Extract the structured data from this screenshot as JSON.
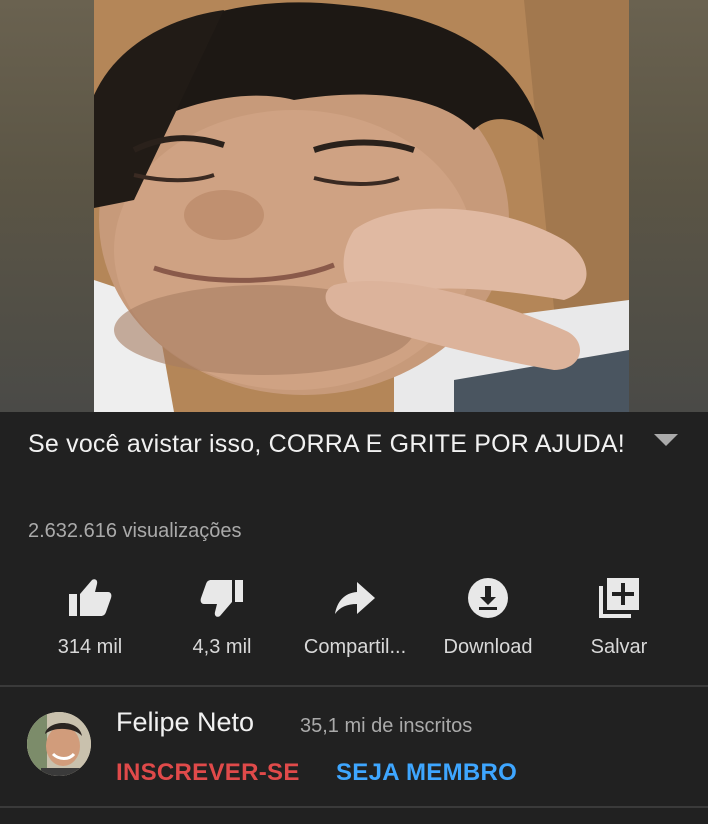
{
  "video": {
    "title": "Se você avistar isso, CORRA E GRITE POR AJUDA!",
    "views": "2.632.616 visualizações"
  },
  "actions": [
    {
      "icon": "thumbs-up-icon",
      "label": "314 mil"
    },
    {
      "icon": "thumbs-down-icon",
      "label": "4,3 mil"
    },
    {
      "icon": "share-icon",
      "label": "Compartil..."
    },
    {
      "icon": "download-icon",
      "label": "Download"
    },
    {
      "icon": "save-playlist-icon",
      "label": "Salvar"
    }
  ],
  "channel": {
    "name": "Felipe Neto",
    "subscribers": "35,1 mi de inscritos",
    "subscribe_label": "INSCREVER-SE",
    "member_label": "SEJA MEMBRO"
  },
  "colors": {
    "background": "#212121",
    "subscribe": "#e04a4a",
    "member": "#3ea6ff"
  }
}
